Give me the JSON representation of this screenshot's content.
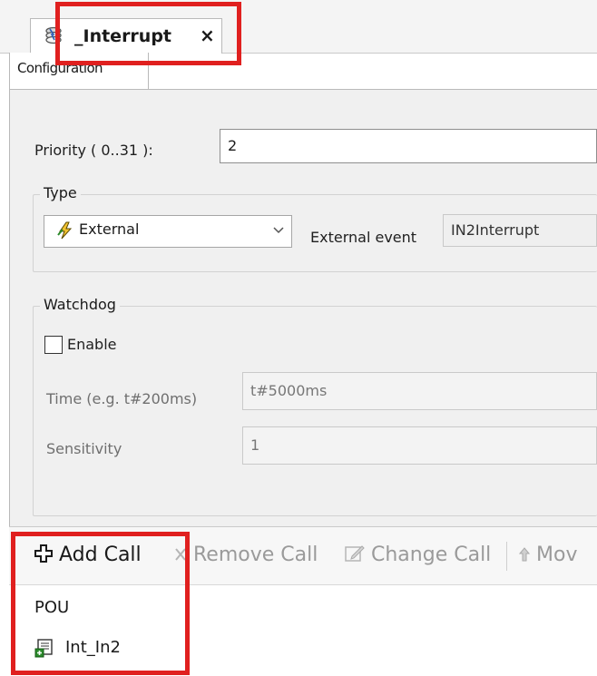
{
  "editor_tab": {
    "title": "_Interrupt",
    "close_glyph": "×",
    "icon": "task-stack-icon"
  },
  "subtab": {
    "label": "Configuration"
  },
  "priority": {
    "label": "Priority ( 0..31 ):",
    "value": "2"
  },
  "type_group": {
    "title": "Type",
    "selected": "External",
    "selected_icon": "lightning-icon",
    "event_label": "External event",
    "event_value": "IN2Interrupt"
  },
  "watchdog_group": {
    "title": "Watchdog",
    "enable_label": "Enable",
    "enable_checked": false,
    "time_label": "Time (e.g. t#200ms)",
    "time_value": "t#5000ms",
    "sensitivity_label": "Sensitivity",
    "sensitivity_value": "1"
  },
  "call_toolbar": {
    "add": "Add Call",
    "remove": "Remove Call",
    "change": "Change Call",
    "move": "Mov"
  },
  "pou_list": {
    "header": "POU",
    "rows": [
      {
        "name": "Int_In2",
        "icon": "program-pou-icon"
      }
    ]
  },
  "colors": {
    "highlight": "#e0201f",
    "panel": "#f0f0f0",
    "accent_icon": "#2b8a2b"
  }
}
